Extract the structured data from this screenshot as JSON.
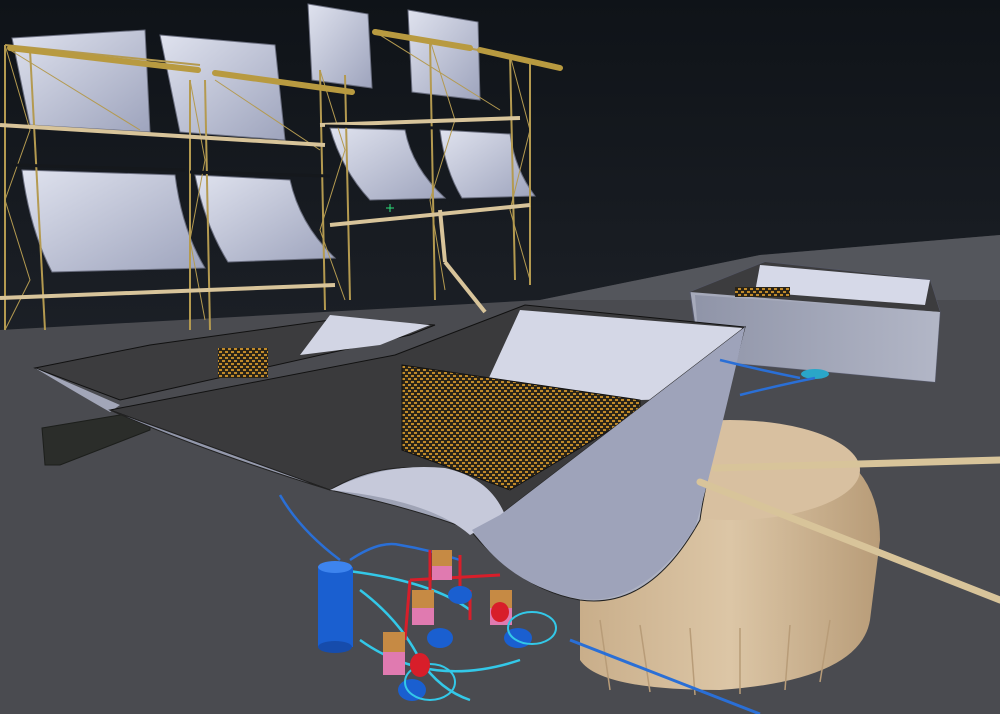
{
  "scene": {
    "colors": {
      "sky_top": "#0f1318",
      "sky_bottom": "#2a2e36",
      "ground": "#4a4b50",
      "ground_far": "#5c5e64",
      "panel": "#c9ccdc",
      "panel_shade": "#9aa0b8",
      "truss": "#b49a50",
      "pipe_tan": "#d8c49a",
      "tank_shell": "#a2a6b8",
      "tank_dark": "#3c3c3e",
      "drum": "#d8c0a0",
      "drum_shade": "#bfa480",
      "louver": "#c08a2a",
      "hose_blue": "#2a6fd6",
      "hose_cyan": "#33c8e8",
      "pump_red": "#d81e2a",
      "motor_pink": "#e07ab0",
      "vessel_blue": "#1a5fd0",
      "crosshair": "#2ee07a"
    }
  }
}
